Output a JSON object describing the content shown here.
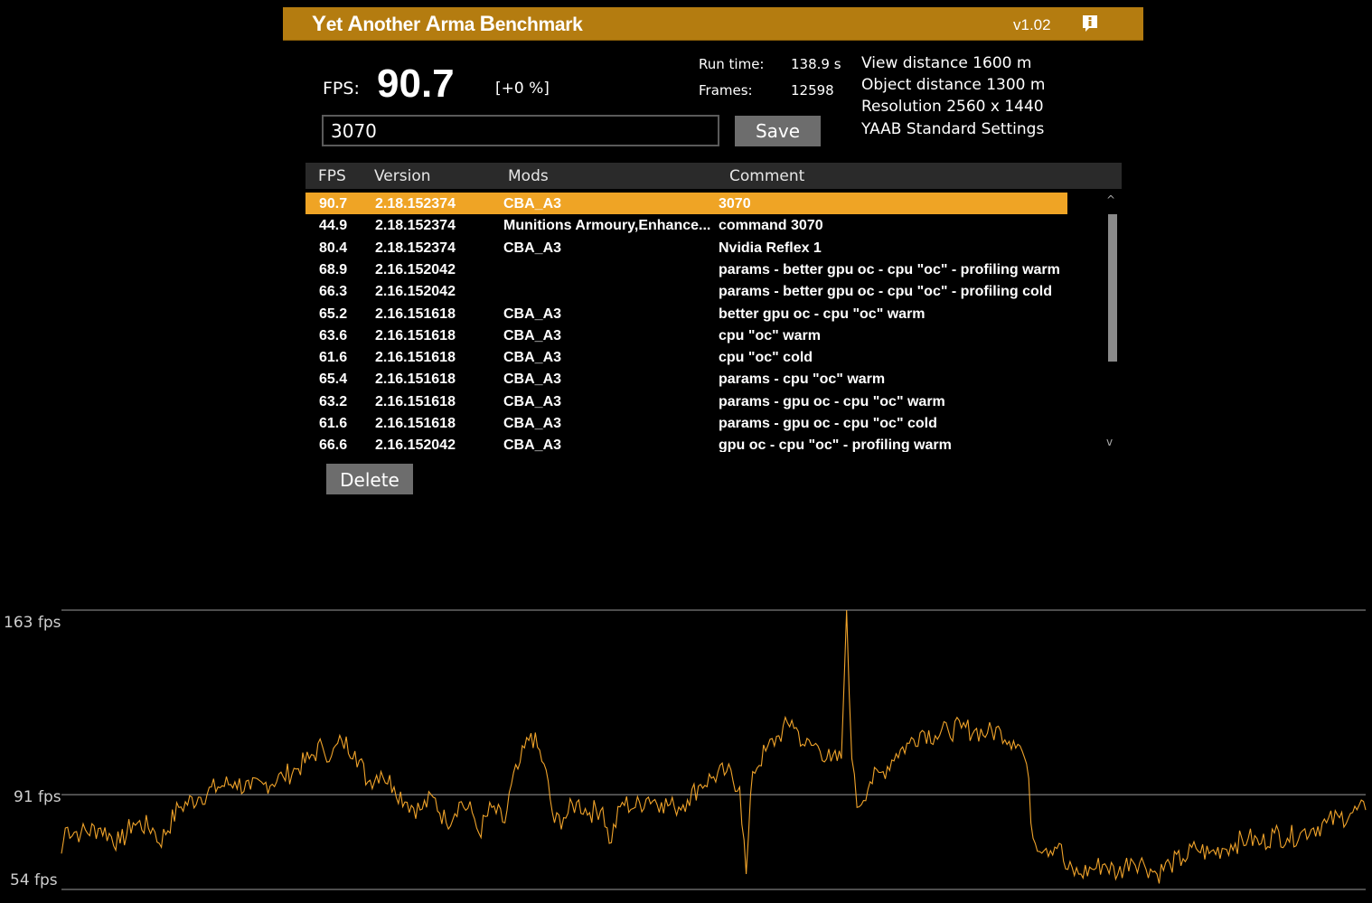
{
  "app": {
    "title_parts": [
      {
        "big": "Y",
        "rest": "et "
      },
      {
        "big": "A",
        "rest": "nother "
      },
      {
        "big": "A",
        "rest": "rma "
      },
      {
        "big": "B",
        "rest": "enchmark"
      }
    ],
    "version": "v1.02",
    "info_icon": "info-icon"
  },
  "summary": {
    "fps_label": "FPS:",
    "fps_value": "90.7",
    "fps_delta": "[+0 %]",
    "run_time_label": "Run time:",
    "run_time_value": "138.9 s",
    "frames_label": "Frames:",
    "frames_value": "12598"
  },
  "settings": {
    "view_distance": "View distance 1600 m",
    "object_distance": "Object distance 1300 m",
    "resolution": "Resolution 2560 x 1440",
    "preset": "YAAB Standard Settings"
  },
  "comment_input": {
    "value": "3070"
  },
  "buttons": {
    "save": "Save",
    "delete": "Delete"
  },
  "table": {
    "headers": {
      "fps": "FPS",
      "version": "Version",
      "mods": "Mods",
      "comment": "Comment"
    },
    "rows": [
      {
        "fps": "90.7",
        "version": "2.18.152374",
        "mods": "CBA_A3",
        "comment": "3070",
        "selected": true
      },
      {
        "fps": "44.9",
        "version": "2.18.152374",
        "mods": "Munitions Armoury,Enhance...",
        "comment": "command 3070"
      },
      {
        "fps": "80.4",
        "version": "2.18.152374",
        "mods": "CBA_A3",
        "comment": "Nvidia Reflex 1"
      },
      {
        "fps": "68.9",
        "version": "2.16.152042",
        "mods": "",
        "comment": "params - better gpu oc - cpu \"oc\" - profiling warm"
      },
      {
        "fps": "66.3",
        "version": "2.16.152042",
        "mods": "",
        "comment": "params - better gpu oc - cpu \"oc\" - profiling cold"
      },
      {
        "fps": "65.2",
        "version": "2.16.151618",
        "mods": "CBA_A3",
        "comment": "better gpu oc - cpu \"oc\" warm"
      },
      {
        "fps": "63.6",
        "version": "2.16.151618",
        "mods": "CBA_A3",
        "comment": "cpu \"oc\" warm"
      },
      {
        "fps": "61.6",
        "version": "2.16.151618",
        "mods": "CBA_A3",
        "comment": "cpu \"oc\" cold"
      },
      {
        "fps": "65.4",
        "version": "2.16.151618",
        "mods": "CBA_A3",
        "comment": "params - cpu \"oc\" warm"
      },
      {
        "fps": "63.2",
        "version": "2.16.151618",
        "mods": "CBA_A3",
        "comment": "params - gpu oc - cpu \"oc\" warm"
      },
      {
        "fps": "61.6",
        "version": "2.16.151618",
        "mods": "CBA_A3",
        "comment": "params - gpu oc - cpu \"oc\" cold"
      },
      {
        "fps": "66.6",
        "version": "2.16.152042",
        "mods": "CBA_A3",
        "comment": "gpu oc - cpu \"oc\" - profiling warm"
      }
    ],
    "scroll_up": "^",
    "scroll_down": "v"
  },
  "colors": {
    "accent": "#b47c10",
    "selected_row": "#efa425",
    "graph_line": "#f0a32a",
    "button": "#6d6d6d"
  },
  "chart_data": {
    "type": "line",
    "y_labels": [
      "163 fps",
      "91 fps",
      "54 fps"
    ],
    "y_gridlines": [
      163,
      91,
      54
    ],
    "ylim": [
      54,
      163
    ],
    "xlim": [
      0,
      100
    ],
    "series": [
      {
        "points": [
          [
            0,
            68
          ],
          [
            0.3,
            78
          ],
          [
            1.5,
            76
          ],
          [
            3,
            78
          ],
          [
            4.5,
            72
          ],
          [
            5.5,
            80
          ],
          [
            7,
            78
          ],
          [
            7.5,
            72
          ],
          [
            9,
            86
          ],
          [
            10.5,
            90
          ],
          [
            12,
            94
          ],
          [
            13.3,
            96
          ],
          [
            14.5,
            93
          ],
          [
            15.5,
            95
          ],
          [
            17,
            98
          ],
          [
            18,
            101
          ],
          [
            19,
            105
          ],
          [
            20,
            110
          ],
          [
            20.7,
            106
          ],
          [
            21.5,
            112
          ],
          [
            22.5,
            108
          ],
          [
            23.5,
            96
          ],
          [
            24.5,
            100
          ],
          [
            25.5,
            94
          ],
          [
            26.5,
            88
          ],
          [
            27.5,
            85
          ],
          [
            28.5,
            90
          ],
          [
            29.5,
            80
          ],
          [
            30.5,
            88
          ],
          [
            31.5,
            84
          ],
          [
            32,
            76
          ],
          [
            33,
            86
          ],
          [
            34,
            80
          ],
          [
            34.5,
            95
          ],
          [
            35,
            101
          ],
          [
            36,
            115
          ],
          [
            37,
            103
          ],
          [
            37.8,
            80
          ],
          [
            38.5,
            82
          ],
          [
            39.5,
            88
          ],
          [
            40.5,
            84
          ],
          [
            41.5,
            86
          ],
          [
            42,
            72
          ],
          [
            43,
            88
          ],
          [
            44,
            86
          ],
          [
            45,
            90
          ],
          [
            46,
            88
          ],
          [
            47,
            86
          ],
          [
            48,
            89
          ],
          [
            49,
            95
          ],
          [
            50,
            98
          ],
          [
            51,
            100
          ],
          [
            52,
            94
          ],
          [
            52.5,
            60
          ],
          [
            53,
            100
          ],
          [
            54,
            108
          ],
          [
            55,
            114
          ],
          [
            56,
            120
          ],
          [
            57,
            110
          ],
          [
            58,
            110
          ],
          [
            59,
            104
          ],
          [
            59.8,
            105
          ],
          [
            60.2,
            163
          ],
          [
            60.6,
            105
          ],
          [
            61,
            86
          ],
          [
            62,
            96
          ],
          [
            63,
            100
          ],
          [
            64,
            107
          ],
          [
            65,
            111
          ],
          [
            66,
            116
          ],
          [
            67,
            114
          ],
          [
            68,
            116
          ],
          [
            69,
            117
          ],
          [
            70,
            116
          ],
          [
            71,
            115
          ],
          [
            72,
            116
          ],
          [
            73,
            112
          ],
          [
            73.5,
            110
          ],
          [
            74,
            103
          ],
          [
            74.5,
            74
          ],
          [
            75.5,
            70
          ],
          [
            76.5,
            72
          ],
          [
            77,
            62
          ],
          [
            78,
            60
          ],
          [
            79,
            62
          ],
          [
            80,
            64
          ],
          [
            81,
            60
          ],
          [
            82,
            66
          ],
          [
            83,
            64
          ],
          [
            84,
            60
          ],
          [
            85,
            64
          ],
          [
            86,
            66
          ],
          [
            87,
            70
          ],
          [
            88,
            68
          ],
          [
            89,
            70
          ],
          [
            90,
            72
          ],
          [
            91,
            74
          ],
          [
            92,
            72
          ],
          [
            93,
            76
          ],
          [
            94,
            74
          ],
          [
            95,
            76
          ],
          [
            96,
            78
          ],
          [
            97,
            80
          ],
          [
            98,
            82
          ],
          [
            99,
            84
          ],
          [
            100,
            85
          ]
        ]
      }
    ]
  }
}
